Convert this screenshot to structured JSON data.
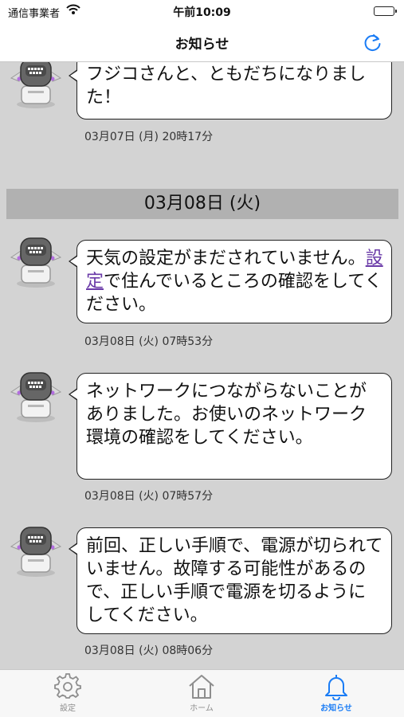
{
  "status_bar": {
    "carrier": "通信事業者",
    "time": "午前10:09"
  },
  "nav": {
    "title": "お知らせ",
    "refresh_icon": "refresh-icon"
  },
  "notifications": [
    {
      "text_before": "フジコさんと、ともだちになりました！",
      "link": "",
      "text_after": "",
      "timestamp": "03月07日 (月) 20時17分"
    },
    {
      "text_before": "天気の設定がまだされていません。",
      "link": "設定",
      "text_after": "で住んでいるところの確認をしてください。",
      "timestamp": "03月08日 (火) 07時53分"
    },
    {
      "text_before": "ネットワークにつながらないことがありました。お使いのネットワーク環境の確認をしてください。",
      "link": "",
      "text_after": "",
      "timestamp": "03月08日 (火) 07時57分"
    },
    {
      "text_before": "前回、正しい手順で、電源が切られていません。故障する可能性があるので、正しい手順で電源を切るようにしてください。",
      "link": "",
      "text_after": "",
      "timestamp": "03月08日 (火) 08時06分"
    }
  ],
  "date_headers": [
    {
      "label": "03月08日 (火)"
    }
  ],
  "tab_bar": {
    "tabs": [
      {
        "label": "設定",
        "icon": "gear-icon",
        "active": false
      },
      {
        "label": "ホーム",
        "icon": "home-icon",
        "active": false
      },
      {
        "label": "お知らせ",
        "icon": "bell-icon",
        "active": true
      }
    ]
  },
  "colors": {
    "background": "#d3d3d3",
    "date_header": "#b1b1b1",
    "accent": "#1a7cf5",
    "link": "#6a3aa8"
  }
}
